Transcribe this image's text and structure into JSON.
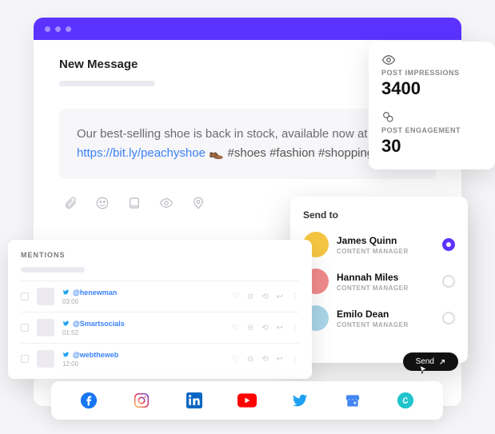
{
  "compose": {
    "title": "New Message",
    "body_text": "Our best-selling shoe is back in stock, available now at ",
    "link": "https://bit.ly/peachyshoe",
    "emoji": "👞",
    "hashtags": "#shoes #fashion #shopping"
  },
  "stats": {
    "impressions_label": "POST IMPRESSIONS",
    "impressions_value": "3400",
    "engagement_label": "POST ENGAGEMENT",
    "engagement_value": "30"
  },
  "send": {
    "title": "Send to",
    "button": "Send",
    "people": [
      {
        "name": "James Quinn",
        "role": "CONTENT MANAGER",
        "selected": true,
        "color": "#F5C542"
      },
      {
        "name": "Hannah Miles",
        "role": "CONTENT MANAGER",
        "selected": false,
        "color": "#F08A8A"
      },
      {
        "name": "Emilo Dean",
        "role": "CONTENT MANAGER",
        "selected": false,
        "color": "#A9D4E8"
      }
    ]
  },
  "mentions": {
    "title": "MENTIONS",
    "rows": [
      {
        "handle": "@henewman",
        "time": "03:00"
      },
      {
        "handle": "@Smartsocials",
        "time": "01:52"
      },
      {
        "handle": "@webtheweb",
        "time": "12:00"
      }
    ]
  },
  "social": [
    "facebook",
    "instagram",
    "linkedin",
    "youtube",
    "twitter",
    "google-business",
    "canva"
  ]
}
